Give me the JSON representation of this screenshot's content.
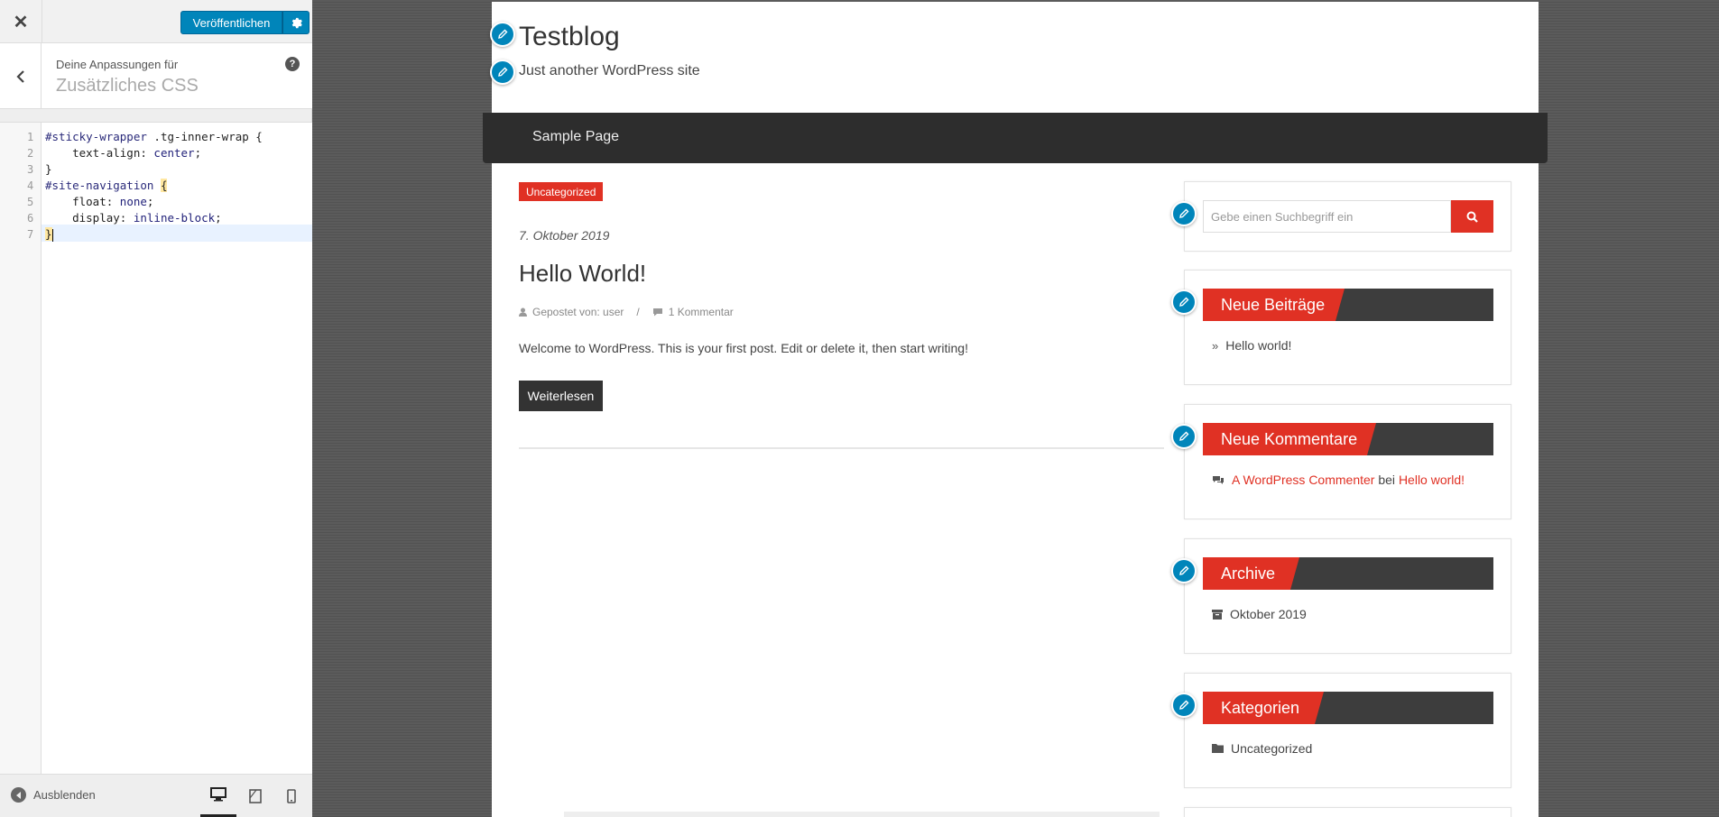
{
  "customizer": {
    "publish_label": "Veröffentlichen",
    "section_subtitle": "Deine Anpassungen für",
    "section_title": "Zusätzliches CSS",
    "footer_hide_label": "Ausblenden",
    "code_lines": [
      {
        "num": "1",
        "sel": "#sticky-wrapper",
        "rest": " .tg-inner-wrap {"
      },
      {
        "num": "2",
        "prop": "    text-align:",
        "val": " center",
        "end": ";"
      },
      {
        "num": "3",
        "plain": "}"
      },
      {
        "num": "4",
        "sel": "#site-navigation",
        "brk": "{"
      },
      {
        "num": "5",
        "prop": "    float:",
        "val": " none",
        "end": ";"
      },
      {
        "num": "6",
        "prop": "    display:",
        "val": " inline-block",
        "end": ";"
      },
      {
        "num": "7",
        "plain": "}"
      }
    ]
  },
  "site": {
    "title": "Testblog",
    "tagline": "Just another WordPress site",
    "nav_item": "Sample Page"
  },
  "post": {
    "category": "Uncategorized",
    "date": "7. Oktober 2019",
    "title": "Hello World!",
    "author_label": "Gepostet von: user",
    "separator": "/",
    "comments_label": "1 Kommentar",
    "excerpt": "Welcome to WordPress. This is your first post. Edit or delete it, then start writing!",
    "read_more": "Weiterlesen"
  },
  "sidebar": {
    "search_placeholder": "Gebe einen Suchbegriff ein",
    "recent_posts": {
      "title": "Neue Beiträge",
      "item": "Hello world!"
    },
    "recent_comments": {
      "title": "Neue Kommentare",
      "author": "A WordPress Commenter",
      "connector": "bei",
      "post": "Hello world!"
    },
    "archive": {
      "title": "Archive",
      "item": "Oktober 2019"
    },
    "categories": {
      "title": "Kategorien",
      "item": "Uncategorized"
    }
  },
  "colors": {
    "accent": "#e03124",
    "wp_blue": "#0085ba",
    "nav_dark": "#2d2d2d"
  }
}
